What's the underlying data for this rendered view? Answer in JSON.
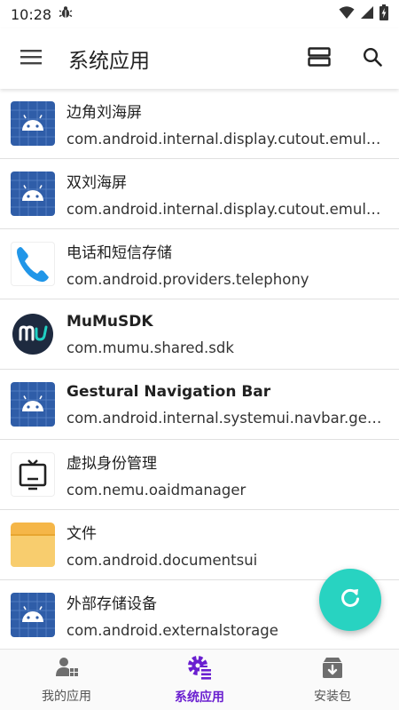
{
  "status_bar": {
    "time": "10:28",
    "notification_icon": "bug-icon",
    "icons": [
      "wifi-icon",
      "signal-icon",
      "battery-charging-icon"
    ]
  },
  "app_bar": {
    "title": "系统应用",
    "menu_icon": "menu-icon",
    "actions": [
      "view-toggle-icon",
      "search-icon"
    ]
  },
  "apps": [
    {
      "name": "边角刘海屏",
      "package": "com.android.internal.display.cutout.emulation.corner",
      "icon": "android-icon"
    },
    {
      "name": "双刘海屏",
      "package": "com.android.internal.display.cutout.emulation.double",
      "icon": "android-icon"
    },
    {
      "name": "电话和短信存储",
      "package": "com.android.providers.telephony",
      "icon": "phone-icon"
    },
    {
      "name": "MuMuSDK",
      "package": "com.mumu.shared.sdk",
      "icon": "mumu-icon"
    },
    {
      "name": "Gestural Navigation Bar",
      "package": "com.android.internal.systemui.navbar.gestural",
      "icon": "android-icon"
    },
    {
      "name": "虚拟身份管理",
      "package": "com.nemu.oaidmanager",
      "icon": "tv-icon"
    },
    {
      "name": "文件",
      "package": "com.android.documentsui",
      "icon": "folder-icon"
    },
    {
      "name": "外部存储设备",
      "package": "com.android.externalstorage",
      "icon": "android-icon"
    }
  ],
  "fab": {
    "icon": "refresh-icon"
  },
  "bottom_nav": {
    "items": [
      {
        "label": "我的应用",
        "icon": "user-apps-icon",
        "active": false
      },
      {
        "label": "系统应用",
        "icon": "system-apps-icon",
        "active": true
      },
      {
        "label": "安装包",
        "icon": "install-package-icon",
        "active": false
      }
    ]
  },
  "colors": {
    "accent": "#6a1fd0",
    "fab": "#28d3c1",
    "android_tile": "#2f5da8"
  }
}
